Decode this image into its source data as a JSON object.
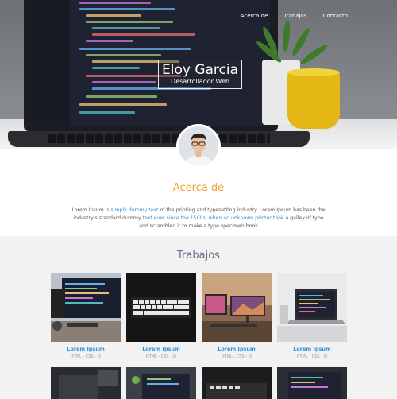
{
  "nav": {
    "items": [
      "Acerca de",
      "Trabajos",
      "Contacto"
    ]
  },
  "hero": {
    "name": "Eloy Garcia",
    "role": "Desarrollador Web"
  },
  "about": {
    "title": "Acerca de",
    "text_1": "Lorem Ipsum ",
    "link_1": "is simply dummy text",
    "text_2": " of the printing and typesetting industry. Lorem Ipsum has been the industry's standard dummy ",
    "link_2": "text ever since the 1500s, when an unknown printer took",
    "text_3": " a galley of type and scrambled it to make a type specimen book"
  },
  "work": {
    "title": "Trabajos",
    "projects": [
      {
        "title": "Lorem Ipsum",
        "tags": "HTML - CSS - JS"
      },
      {
        "title": "Lorem Ipsum",
        "tags": "HTML - CSS - JS"
      },
      {
        "title": "Lorem Ipsum",
        "tags": "HTML - CSS - JS"
      },
      {
        "title": "Lorem Ipsum",
        "tags": "HTML - CSS - JS"
      }
    ]
  },
  "colors": {
    "accent_orange": "#f0a030",
    "link_blue": "#2f8fd8",
    "section_title": "#6a6d83"
  }
}
